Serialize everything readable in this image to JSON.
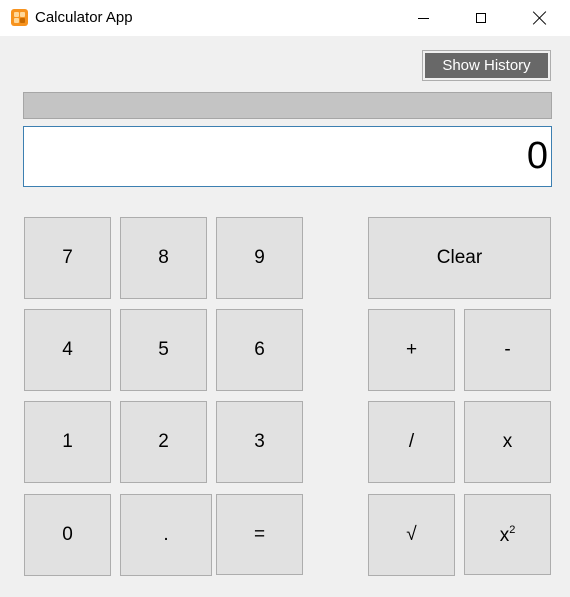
{
  "window": {
    "title": "Calculator App"
  },
  "titlebar_icons": {
    "app": "calculator-app-icon",
    "minimize": "minimize-icon",
    "maximize": "maximize-icon",
    "close": "close-icon"
  },
  "history": {
    "button_label": "Show History"
  },
  "display": {
    "value": "0"
  },
  "keys": {
    "seven": "7",
    "eight": "8",
    "nine": "9",
    "four": "4",
    "five": "5",
    "six": "6",
    "one": "1",
    "two": "2",
    "three": "3",
    "zero": "0",
    "decimal": ".",
    "equals": "=",
    "clear": "Clear",
    "add": "+",
    "subtract": "-",
    "divide": "/",
    "multiply": "x",
    "sqrt": "√",
    "square_base": "x",
    "square_exp": "2"
  },
  "colors": {
    "window_bg": "#f0f0f0",
    "key_bg": "#e1e1e1",
    "key_border": "#adadad",
    "history_button_bg": "#686868",
    "display_border": "#3c7fb1"
  }
}
